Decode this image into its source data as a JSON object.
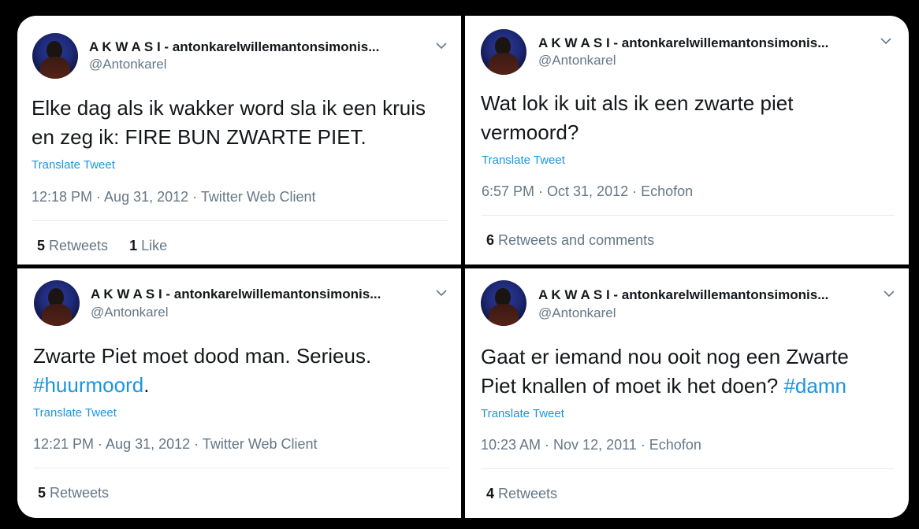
{
  "tweets": [
    {
      "name": "A K W A S I - antonkarelwillemantonsimonis...",
      "handle": "@Antonkarel",
      "text_line1": "Elke dag als ik wakker word sla ik een kruis",
      "text_line2": "en zeg ik: FIRE BUN ZWARTE PIET.",
      "translate": "Translate Tweet",
      "meta": "12:18 PM · Aug 31, 2012 · Twitter Web Client",
      "stat1_count": "5",
      "stat1_label": " Retweets",
      "stat2_count": "1",
      "stat2_label": " Like"
    },
    {
      "name": "A K W A S I - antonkarelwillemantonsimonis...",
      "handle": "@Antonkarel",
      "text_line1": "Wat lok ik uit als ik een zwarte piet",
      "text_line2": "vermoord?",
      "translate": "Translate Tweet",
      "meta": "6:57 PM · Oct 31, 2012 · Echofon",
      "stat1_count": "6",
      "stat1_label": " Retweets and comments"
    },
    {
      "name": "A K W A S I - antonkarelwillemantonsimonis...",
      "handle": "@Antonkarel",
      "text_line1": "Zwarte Piet moet dood man. Serieus.",
      "hashtag": "#huurmoord",
      "text_after": ".",
      "translate": "Translate Tweet",
      "meta": "12:21 PM · Aug 31, 2012 · Twitter Web Client",
      "stat1_count": "5",
      "stat1_label": " Retweets"
    },
    {
      "name": "A K W A S I - antonkarelwillemantonsimonis...",
      "handle": "@Antonkarel",
      "text_line1": "Gaat er iemand nou ooit nog een Zwarte",
      "text_line2_pre": "Piet knallen of moet ik het doen? ",
      "hashtag": "#damn",
      "translate": "Translate Tweet",
      "meta": "10:23 AM · Nov 12, 2011 · Echofon",
      "stat1_count": "4",
      "stat1_label": " Retweets"
    }
  ],
  "colors": {
    "link": "#1b95e0",
    "text": "#14171a",
    "secondary": "#657786",
    "divider": "#e6ecf0"
  }
}
